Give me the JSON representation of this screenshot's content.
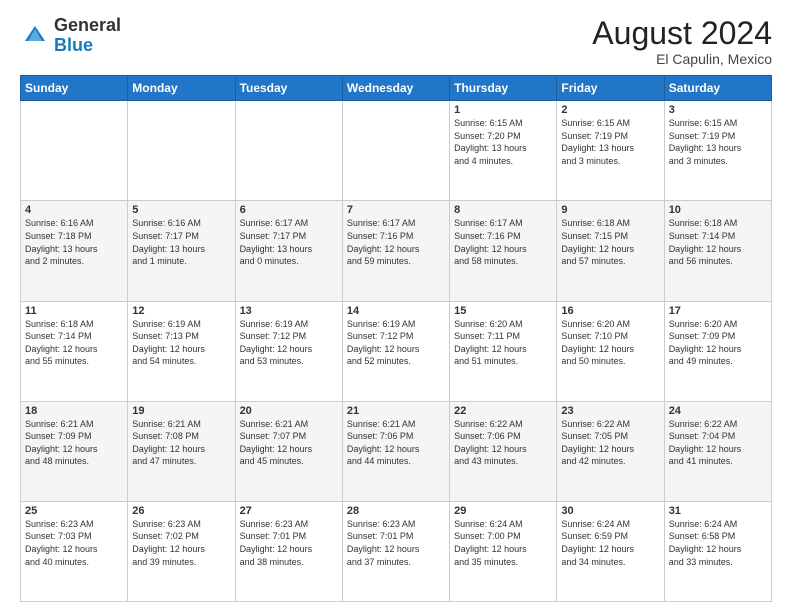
{
  "logo": {
    "general": "General",
    "blue": "Blue"
  },
  "header": {
    "month_year": "August 2024",
    "location": "El Capulin, Mexico"
  },
  "weekdays": [
    "Sunday",
    "Monday",
    "Tuesday",
    "Wednesday",
    "Thursday",
    "Friday",
    "Saturday"
  ],
  "weeks": [
    [
      {
        "day": "",
        "info": ""
      },
      {
        "day": "",
        "info": ""
      },
      {
        "day": "",
        "info": ""
      },
      {
        "day": "",
        "info": ""
      },
      {
        "day": "1",
        "info": "Sunrise: 6:15 AM\nSunset: 7:20 PM\nDaylight: 13 hours\nand 4 minutes."
      },
      {
        "day": "2",
        "info": "Sunrise: 6:15 AM\nSunset: 7:19 PM\nDaylight: 13 hours\nand 3 minutes."
      },
      {
        "day": "3",
        "info": "Sunrise: 6:15 AM\nSunset: 7:19 PM\nDaylight: 13 hours\nand 3 minutes."
      }
    ],
    [
      {
        "day": "4",
        "info": "Sunrise: 6:16 AM\nSunset: 7:18 PM\nDaylight: 13 hours\nand 2 minutes."
      },
      {
        "day": "5",
        "info": "Sunrise: 6:16 AM\nSunset: 7:17 PM\nDaylight: 13 hours\nand 1 minute."
      },
      {
        "day": "6",
        "info": "Sunrise: 6:17 AM\nSunset: 7:17 PM\nDaylight: 13 hours\nand 0 minutes."
      },
      {
        "day": "7",
        "info": "Sunrise: 6:17 AM\nSunset: 7:16 PM\nDaylight: 12 hours\nand 59 minutes."
      },
      {
        "day": "8",
        "info": "Sunrise: 6:17 AM\nSunset: 7:16 PM\nDaylight: 12 hours\nand 58 minutes."
      },
      {
        "day": "9",
        "info": "Sunrise: 6:18 AM\nSunset: 7:15 PM\nDaylight: 12 hours\nand 57 minutes."
      },
      {
        "day": "10",
        "info": "Sunrise: 6:18 AM\nSunset: 7:14 PM\nDaylight: 12 hours\nand 56 minutes."
      }
    ],
    [
      {
        "day": "11",
        "info": "Sunrise: 6:18 AM\nSunset: 7:14 PM\nDaylight: 12 hours\nand 55 minutes."
      },
      {
        "day": "12",
        "info": "Sunrise: 6:19 AM\nSunset: 7:13 PM\nDaylight: 12 hours\nand 54 minutes."
      },
      {
        "day": "13",
        "info": "Sunrise: 6:19 AM\nSunset: 7:12 PM\nDaylight: 12 hours\nand 53 minutes."
      },
      {
        "day": "14",
        "info": "Sunrise: 6:19 AM\nSunset: 7:12 PM\nDaylight: 12 hours\nand 52 minutes."
      },
      {
        "day": "15",
        "info": "Sunrise: 6:20 AM\nSunset: 7:11 PM\nDaylight: 12 hours\nand 51 minutes."
      },
      {
        "day": "16",
        "info": "Sunrise: 6:20 AM\nSunset: 7:10 PM\nDaylight: 12 hours\nand 50 minutes."
      },
      {
        "day": "17",
        "info": "Sunrise: 6:20 AM\nSunset: 7:09 PM\nDaylight: 12 hours\nand 49 minutes."
      }
    ],
    [
      {
        "day": "18",
        "info": "Sunrise: 6:21 AM\nSunset: 7:09 PM\nDaylight: 12 hours\nand 48 minutes."
      },
      {
        "day": "19",
        "info": "Sunrise: 6:21 AM\nSunset: 7:08 PM\nDaylight: 12 hours\nand 47 minutes."
      },
      {
        "day": "20",
        "info": "Sunrise: 6:21 AM\nSunset: 7:07 PM\nDaylight: 12 hours\nand 45 minutes."
      },
      {
        "day": "21",
        "info": "Sunrise: 6:21 AM\nSunset: 7:06 PM\nDaylight: 12 hours\nand 44 minutes."
      },
      {
        "day": "22",
        "info": "Sunrise: 6:22 AM\nSunset: 7:06 PM\nDaylight: 12 hours\nand 43 minutes."
      },
      {
        "day": "23",
        "info": "Sunrise: 6:22 AM\nSunset: 7:05 PM\nDaylight: 12 hours\nand 42 minutes."
      },
      {
        "day": "24",
        "info": "Sunrise: 6:22 AM\nSunset: 7:04 PM\nDaylight: 12 hours\nand 41 minutes."
      }
    ],
    [
      {
        "day": "25",
        "info": "Sunrise: 6:23 AM\nSunset: 7:03 PM\nDaylight: 12 hours\nand 40 minutes."
      },
      {
        "day": "26",
        "info": "Sunrise: 6:23 AM\nSunset: 7:02 PM\nDaylight: 12 hours\nand 39 minutes."
      },
      {
        "day": "27",
        "info": "Sunrise: 6:23 AM\nSunset: 7:01 PM\nDaylight: 12 hours\nand 38 minutes."
      },
      {
        "day": "28",
        "info": "Sunrise: 6:23 AM\nSunset: 7:01 PM\nDaylight: 12 hours\nand 37 minutes."
      },
      {
        "day": "29",
        "info": "Sunrise: 6:24 AM\nSunset: 7:00 PM\nDaylight: 12 hours\nand 35 minutes."
      },
      {
        "day": "30",
        "info": "Sunrise: 6:24 AM\nSunset: 6:59 PM\nDaylight: 12 hours\nand 34 minutes."
      },
      {
        "day": "31",
        "info": "Sunrise: 6:24 AM\nSunset: 6:58 PM\nDaylight: 12 hours\nand 33 minutes."
      }
    ]
  ]
}
